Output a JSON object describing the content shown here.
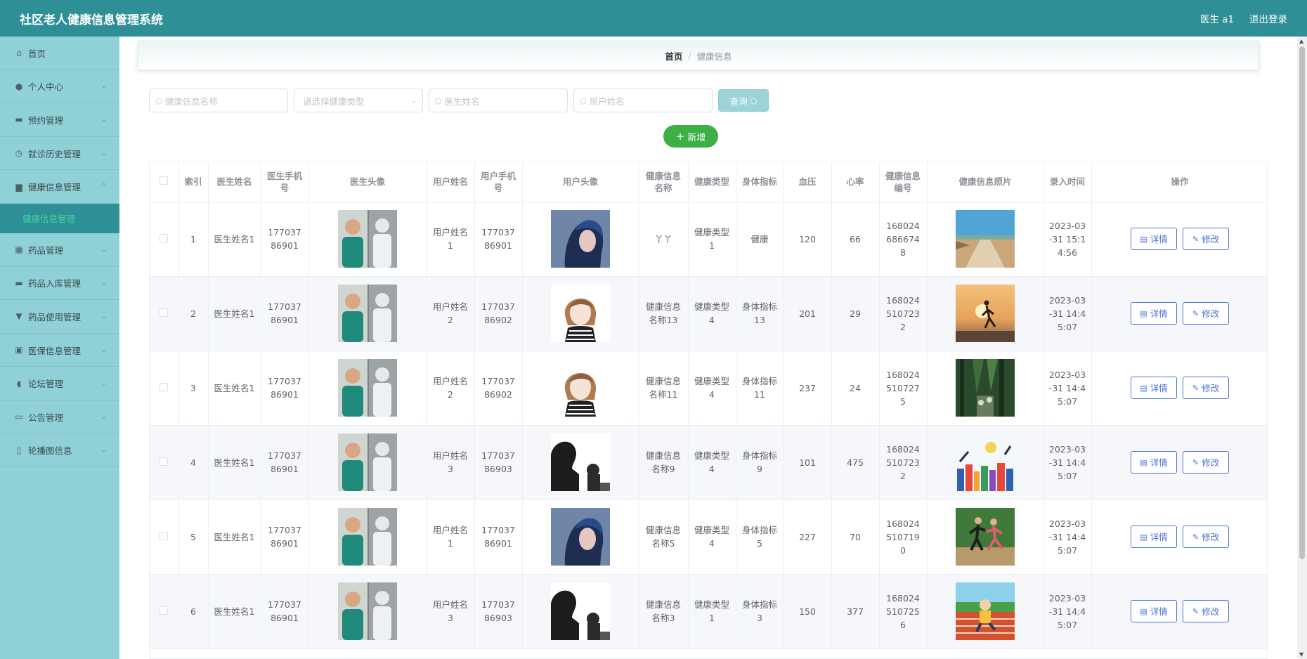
{
  "header": {
    "title": "社区老人健康信息管理系统",
    "user": "医生 a1",
    "logout": "退出登录"
  },
  "sidebar": {
    "items": [
      {
        "label": "首页",
        "icon": "home-icon",
        "glyph": "⌂",
        "chevron": ""
      },
      {
        "label": "个人中心",
        "icon": "user-icon",
        "glyph": "●",
        "chevron": "⌄"
      },
      {
        "label": "预约管理",
        "icon": "ticket-icon",
        "glyph": "▬",
        "chevron": "⌄"
      },
      {
        "label": "就诊历史管理",
        "icon": "clock-icon",
        "glyph": "◷",
        "chevron": "⌄"
      },
      {
        "label": "健康信息管理",
        "icon": "folder-icon",
        "glyph": "▆",
        "chevron": "⌃"
      }
    ],
    "submenu": "健康信息管理",
    "items2": [
      {
        "label": "药品管理",
        "icon": "grid-icon",
        "glyph": "▦",
        "chevron": "⌄"
      },
      {
        "label": "药品入库管理",
        "icon": "box-icon",
        "glyph": "▬",
        "chevron": "⌄"
      },
      {
        "label": "药品使用管理",
        "icon": "cup-icon",
        "glyph": "▼",
        "chevron": "⌄"
      },
      {
        "label": "医保信息管理",
        "icon": "clipboard-icon",
        "glyph": "▣",
        "chevron": "⌄"
      },
      {
        "label": "论坛管理",
        "icon": "mic-icon",
        "glyph": "◖",
        "chevron": "⌄"
      },
      {
        "label": "公告管理",
        "icon": "monitor-icon",
        "glyph": "▭",
        "chevron": "⌄"
      },
      {
        "label": "轮播图信息",
        "icon": "phone-icon",
        "glyph": "▯",
        "chevron": "⌄"
      }
    ]
  },
  "breadcrumb": {
    "home": "首页",
    "sep": "/",
    "current": "健康信息"
  },
  "search": {
    "name_placeholder": "健康信息名称",
    "type_placeholder": "请选择健康类型",
    "doctor_placeholder": "医生姓名",
    "user_placeholder": "用户姓名",
    "query_label": "查询",
    "query_icon": "search-icon"
  },
  "add_label": "新增",
  "table": {
    "headers": [
      "",
      "索引",
      "医生姓名",
      "医生手机号",
      "医生头像",
      "用户姓名",
      "用户手机号",
      "用户头像",
      "健康信息名称",
      "健康类型",
      "身体指标",
      "血压",
      "心率",
      "健康信息编号",
      "健康信息照片",
      "录入时间",
      "操作"
    ],
    "detail_label": "详情",
    "edit_label": "修改",
    "rows": [
      {
        "index": "1",
        "doctor": "医生姓名1",
        "doctor_phone": "17703786901",
        "user": "用户姓名1",
        "user_phone": "17703786901",
        "name": "丫丫",
        "type": "健康类型1",
        "indicator": "健康",
        "bp": "120",
        "hr": "66",
        "code": "1680246866748",
        "time": "2023-03-31 15:14:56",
        "avatar": "blue-portrait",
        "photo": "beach-road"
      },
      {
        "index": "2",
        "doctor": "医生姓名1",
        "doctor_phone": "17703786901",
        "user": "用户姓名2",
        "user_phone": "17703786902",
        "name": "健康信息名称13",
        "type": "健康类型4",
        "indicator": "身体指标13",
        "bp": "201",
        "hr": "29",
        "code": "1680245107232",
        "time": "2023-03-31 14:45:07",
        "avatar": "cartoon-girl",
        "photo": "sunset-runner"
      },
      {
        "index": "3",
        "doctor": "医生姓名1",
        "doctor_phone": "17703786901",
        "user": "用户姓名2",
        "user_phone": "17703786902",
        "name": "健康信息名称11",
        "type": "健康类型4",
        "indicator": "身体指标11",
        "bp": "237",
        "hr": "24",
        "code": "1680245107275",
        "time": "2023-03-31 14:45:07",
        "avatar": "cartoon-girl",
        "photo": "forest-cyclists"
      },
      {
        "index": "4",
        "doctor": "医生姓名1",
        "doctor_phone": "17703786901",
        "user": "用户姓名3",
        "user_phone": "17703786903",
        "name": "健康信息名称9",
        "type": "健康类型4",
        "indicator": "身体指标9",
        "bp": "101",
        "hr": "475",
        "code": "1680245107232",
        "time": "2023-03-31 14:45:07",
        "avatar": "bw-silhouette",
        "photo": "city-illustration"
      },
      {
        "index": "5",
        "doctor": "医生姓名1",
        "doctor_phone": "17703786901",
        "user": "用户姓名1",
        "user_phone": "17703786901",
        "name": "健康信息名称5",
        "type": "健康类型4",
        "indicator": "身体指标5",
        "bp": "227",
        "hr": "70",
        "code": "1680245107190",
        "time": "2023-03-31 14:45:07",
        "avatar": "blue-portrait",
        "photo": "park-exercise"
      },
      {
        "index": "6",
        "doctor": "医生姓名1",
        "doctor_phone": "17703786901",
        "user": "用户姓名3",
        "user_phone": "17703786903",
        "name": "健康信息名称3",
        "type": "健康类型1",
        "indicator": "身体指标3",
        "bp": "150",
        "hr": "377",
        "code": "1680245107256",
        "time": "2023-03-31 14:45:07",
        "avatar": "bw-silhouette",
        "photo": "track-cartoon"
      }
    ]
  }
}
